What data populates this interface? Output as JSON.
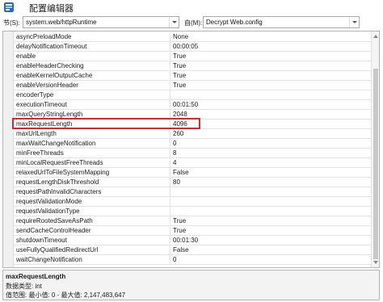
{
  "window": {
    "title": "配置编辑器"
  },
  "toolbar": {
    "section_label": "节(S):",
    "section_value": "system.web/httpRuntime",
    "from_label": "自(M):",
    "from_value": "Decrypt Web.config"
  },
  "properties": [
    {
      "name": "asyncPreloadMode",
      "value": "None"
    },
    {
      "name": "delayNotificationTimeout",
      "value": "00:00:05"
    },
    {
      "name": "enable",
      "value": "True"
    },
    {
      "name": "enableHeaderChecking",
      "value": "True"
    },
    {
      "name": "enableKernelOutputCache",
      "value": "True"
    },
    {
      "name": "enableVersionHeader",
      "value": "True"
    },
    {
      "name": "encoderType",
      "value": ""
    },
    {
      "name": "executionTimeout",
      "value": "00:01:50"
    },
    {
      "name": "maxQueryStringLength",
      "value": "2048"
    },
    {
      "name": "maxRequestLength",
      "value": "4096"
    },
    {
      "name": "maxUrlLength",
      "value": "260"
    },
    {
      "name": "maxWaitChangeNotification",
      "value": "0"
    },
    {
      "name": "minFreeThreads",
      "value": "8"
    },
    {
      "name": "minLocalRequestFreeThreads",
      "value": "4"
    },
    {
      "name": "relaxedUrlToFileSystemMapping",
      "value": "False"
    },
    {
      "name": "requestLengthDiskThreshold",
      "value": "80"
    },
    {
      "name": "requestPathInvalidCharacters",
      "value": ""
    },
    {
      "name": "requestValidationMode",
      "value": ""
    },
    {
      "name": "requestValidationType",
      "value": ""
    },
    {
      "name": "requireRootedSaveAsPath",
      "value": "True"
    },
    {
      "name": "sendCacheControlHeader",
      "value": "True"
    },
    {
      "name": "shutdownTimeout",
      "value": "00:01:30"
    },
    {
      "name": "useFullyQualifiedRedirectUrl",
      "value": "False"
    },
    {
      "name": "waitChangeNotification",
      "value": "0"
    }
  ],
  "highlighted_property": "maxRequestLength",
  "description": {
    "title": "maxRequestLength",
    "type_line": "数据类型: int",
    "range_line": "值范围: 最小值: 0 - 最大值: 2,147,483,647"
  },
  "colors": {
    "highlight_border": "#d42a2a"
  }
}
